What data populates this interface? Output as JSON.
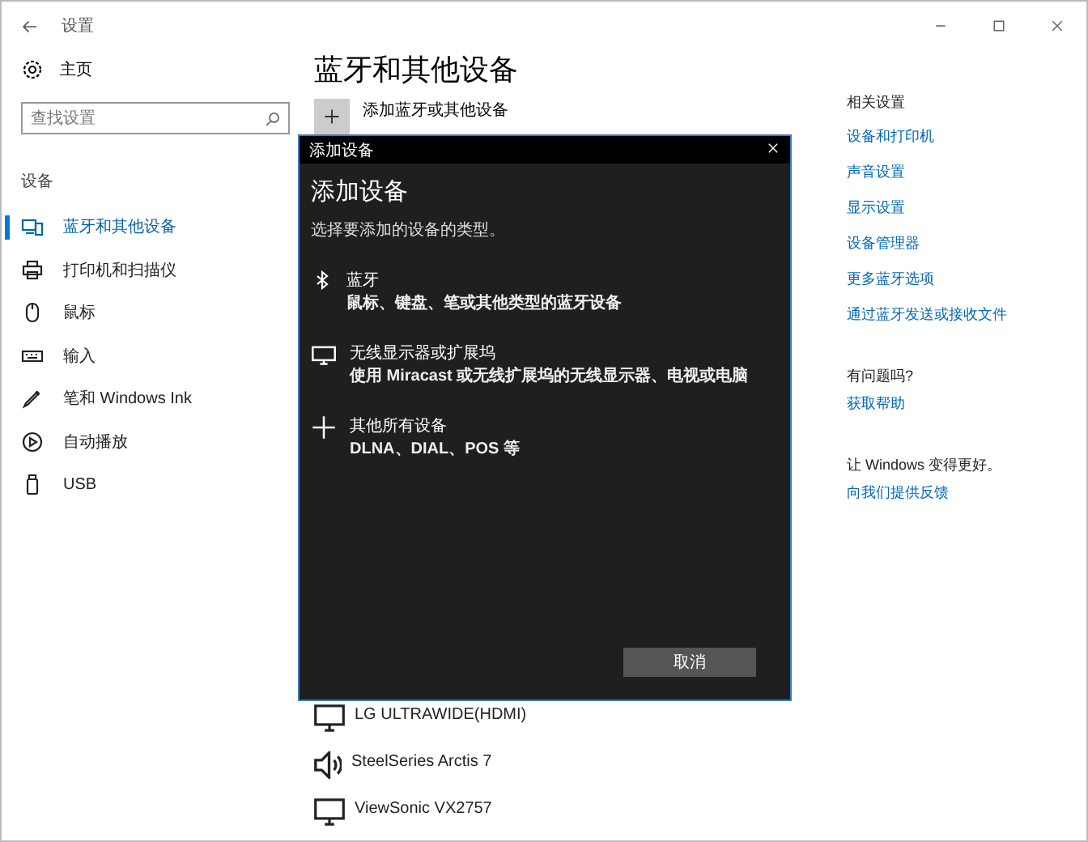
{
  "window": {
    "title": "设置"
  },
  "sidebar": {
    "home": "主页",
    "search": {
      "placeholder": "查找设置"
    },
    "section": "设备",
    "items": [
      {
        "label": "蓝牙和其他设备",
        "kind": "devices",
        "selected": true
      },
      {
        "label": "打印机和扫描仪",
        "kind": "printer",
        "selected": false
      },
      {
        "label": "鼠标",
        "kind": "mouse",
        "selected": false
      },
      {
        "label": "输入",
        "kind": "keyboard",
        "selected": false
      },
      {
        "label": "笔和 Windows Ink",
        "kind": "pen",
        "selected": false
      },
      {
        "label": "自动播放",
        "kind": "autoplay",
        "selected": false
      },
      {
        "label": "USB",
        "kind": "usb",
        "selected": false
      }
    ]
  },
  "main": {
    "title": "蓝牙和其他设备",
    "add_button": "添加蓝牙或其他设备",
    "devices": [
      {
        "name": "LG ULTRAWIDE(HDMI)",
        "kind": "monitor"
      },
      {
        "name": "SteelSeries Arctis 7",
        "kind": "speaker"
      },
      {
        "name": "ViewSonic VX2757",
        "kind": "monitor"
      }
    ]
  },
  "related": {
    "heading": "相关设置",
    "links": [
      "设备和打印机",
      "声音设置",
      "显示设置",
      "设备管理器",
      "更多蓝牙选项",
      "通过蓝牙发送或接收文件"
    ],
    "help_heading": "有问题吗?",
    "help_link": "获取帮助",
    "feedback_heading": "让 Windows 变得更好。",
    "feedback_link": "向我们提供反馈"
  },
  "dialog": {
    "title": "添加设备",
    "heading": "添加设备",
    "prompt": "选择要添加的设备的类型。",
    "options": [
      {
        "kind": "bluetooth",
        "title": "蓝牙",
        "subtitle": "鼠标、键盘、笔或其他类型的蓝牙设备"
      },
      {
        "kind": "display",
        "title": "无线显示器或扩展坞",
        "subtitle": "使用 Miracast 或无线扩展坞的无线显示器、电视或电脑"
      },
      {
        "kind": "other",
        "title": "其他所有设备",
        "subtitle": "DLNA、DIAL、POS 等"
      }
    ],
    "cancel": "取消"
  }
}
